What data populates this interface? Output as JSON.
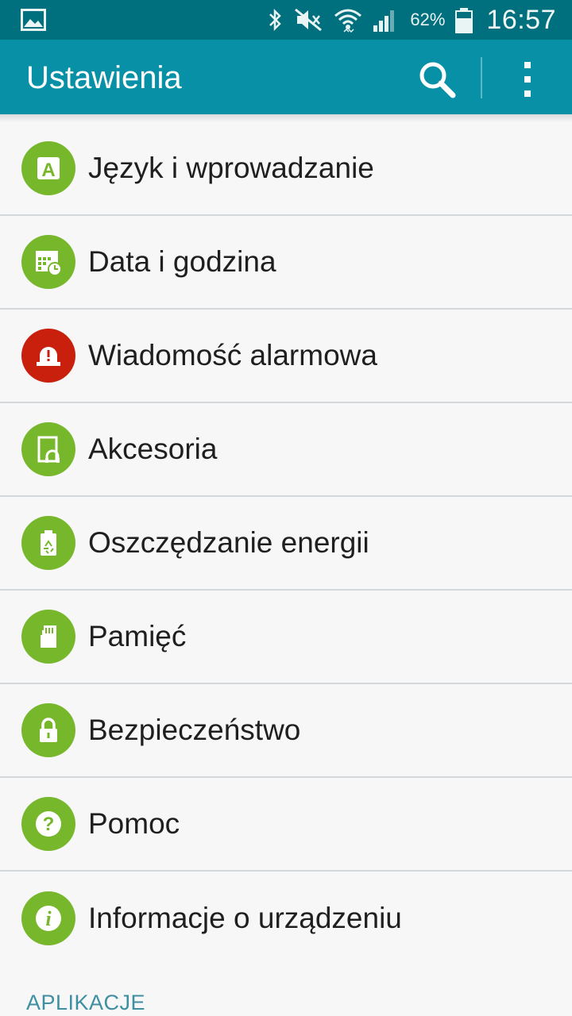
{
  "status_bar": {
    "battery_percent": "62%",
    "time": "16:57",
    "icons": [
      "gallery-icon",
      "bluetooth-icon",
      "mute-icon",
      "wifi-icon",
      "signal-icon",
      "battery-icon"
    ]
  },
  "action_bar": {
    "title": "Ustawienia",
    "search_icon": "search-icon",
    "overflow_icon": "more-vert-icon"
  },
  "colors": {
    "status_bar": "#00707f",
    "action_bar": "#0891a6",
    "icon_green": "#77b72b",
    "icon_red": "#c8200c",
    "section_header": "#3d8fa1"
  },
  "items": [
    {
      "label": "Język i wprowadzanie",
      "icon": "language-icon"
    },
    {
      "label": "Data i godzina",
      "icon": "date-time-icon"
    },
    {
      "label": "Wiadomość alarmowa",
      "icon": "emergency-alert-icon"
    },
    {
      "label": "Akcesoria",
      "icon": "accessories-icon"
    },
    {
      "label": "Oszczędzanie energii",
      "icon": "power-saving-icon"
    },
    {
      "label": "Pamięć",
      "icon": "storage-icon"
    },
    {
      "label": "Bezpieczeństwo",
      "icon": "security-icon"
    },
    {
      "label": "Pomoc",
      "icon": "help-icon"
    },
    {
      "label": "Informacje o urządzeniu",
      "icon": "info-icon"
    }
  ],
  "section": {
    "header": "APLIKACJE"
  }
}
